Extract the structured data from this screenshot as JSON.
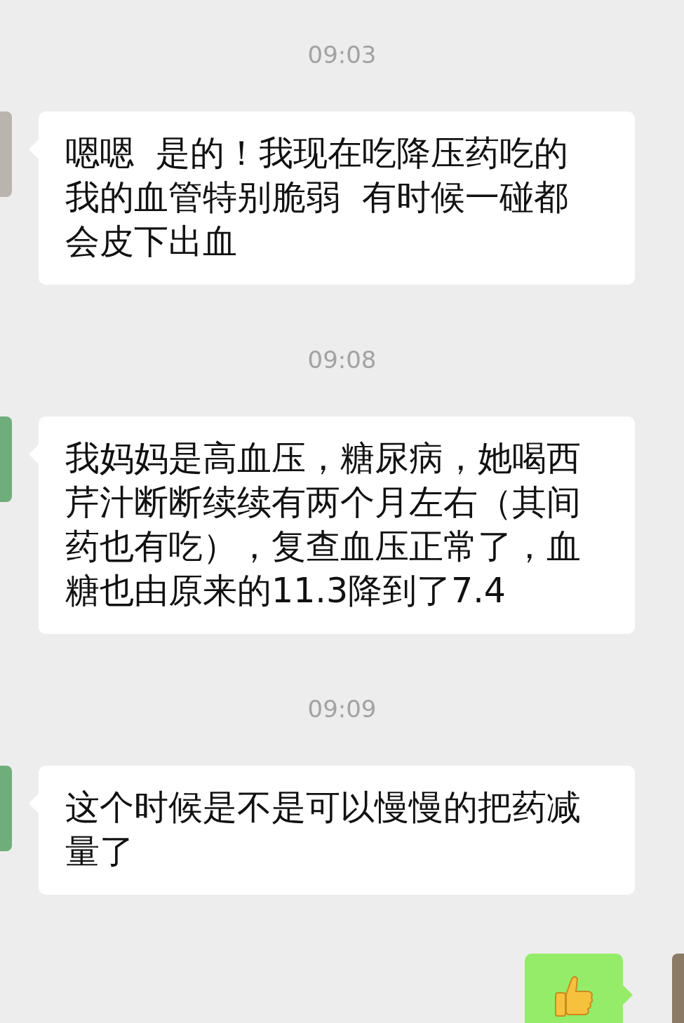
{
  "messages": [
    {
      "kind": "time",
      "text": "09:03"
    },
    {
      "kind": "text",
      "outgoing": false,
      "text": "嗯嗯  是的！我现在吃降压药吃的我的血管特别脆弱  有时候一碰都会皮下出血"
    },
    {
      "kind": "time",
      "text": "09:08"
    },
    {
      "kind": "text",
      "outgoing": false,
      "text": "我妈妈是高血压，糖尿病，她喝西芹汁断断续续有两个月左右（其间药也有吃），复查血压正常了，血糖也由原来的11.3降到了7.4"
    },
    {
      "kind": "time",
      "text": "09:09"
    },
    {
      "kind": "text",
      "outgoing": false,
      "text": "这个时候是不是可以慢慢的把药减量了"
    },
    {
      "kind": "thumbs_up",
      "outgoing": true
    }
  ]
}
